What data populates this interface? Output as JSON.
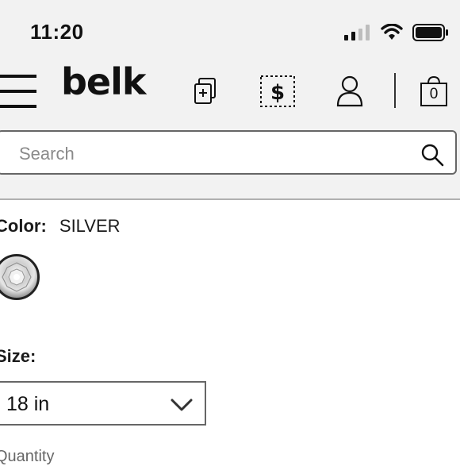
{
  "status_bar": {
    "time": "11:20"
  },
  "header": {
    "logo": "belk",
    "cart_count": "0"
  },
  "search": {
    "placeholder": "Search"
  },
  "product": {
    "color_label": "Color:",
    "color_value": "SILVER",
    "size_label": "Size:",
    "size_value": "18 in",
    "quantity_label": "Quantity"
  },
  "colors": {
    "background": "#ffffff",
    "header_bg": "#f2f2f2",
    "text": "#1a1a1a",
    "placeholder": "#8a8a8a"
  }
}
